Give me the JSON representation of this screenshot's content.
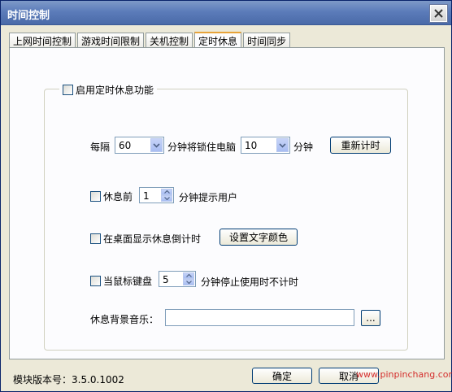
{
  "window": {
    "title": "时间控制"
  },
  "tabs": [
    {
      "label": "上网时间控制",
      "active": false
    },
    {
      "label": "游戏时间限制",
      "active": false
    },
    {
      "label": "关机控制",
      "active": false
    },
    {
      "label": "定时休息",
      "active": true
    },
    {
      "label": "时间同步",
      "active": false
    }
  ],
  "rest": {
    "enable_label": "启用定时休息功能",
    "interval_prefix": "每隔",
    "interval_value": "60",
    "interval_middle": "分钟将锁住电脑",
    "lock_value": "10",
    "lock_suffix": "分钟",
    "restart_button": "重新计时",
    "pre_rest_label": "休息前",
    "pre_rest_value": "1",
    "pre_rest_suffix": "分钟提示用户",
    "desktop_countdown_label": "在桌面显示休息倒计时",
    "text_color_button": "设置文字颜色",
    "idle_label": "当鼠标键盘",
    "idle_value": "5",
    "idle_suffix": "分钟停止使用时不计时",
    "music_label": "休息背景音乐：",
    "music_value": "",
    "browse_button": "..."
  },
  "footer": {
    "version_label": "模块版本号：3.5.0.1002",
    "ok_button": "确定",
    "cancel_button": "取消",
    "watermark": "www.pinpinchang.com"
  },
  "colors": {
    "title_bar": "#5c7cba",
    "window_bg": "#ece9d8",
    "panel_bg": "#fcfcfe",
    "active_tab_accent": "#e7a33a"
  }
}
